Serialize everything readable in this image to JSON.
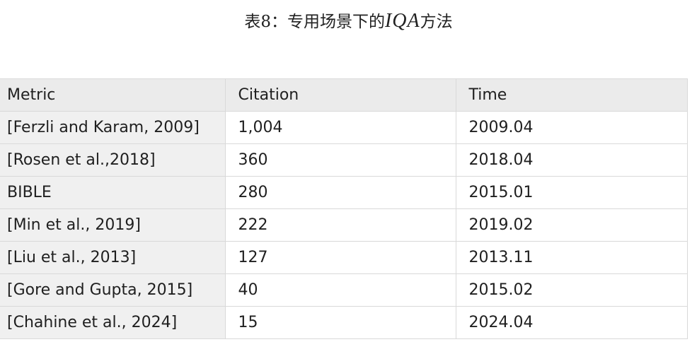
{
  "caption": {
    "prefix": "表8：专用场景下的",
    "math": "IQA",
    "suffix": "方法"
  },
  "table": {
    "headers": [
      "Metric",
      "Citation",
      "Time"
    ],
    "rows": [
      [
        "[Ferzli and Karam, 2009]",
        "1,004",
        "2009.04"
      ],
      [
        "[Rosen et al.,2018]",
        "360",
        "2018.04"
      ],
      [
        "BIBLE",
        "280",
        "2015.01"
      ],
      [
        "[Min et al., 2019]",
        "222",
        "2019.02"
      ],
      [
        "[Liu et al., 2013]",
        "127",
        "2013.11"
      ],
      [
        "[Gore and Gupta, 2015]",
        "40",
        "2015.02"
      ],
      [
        "[Chahine et al., 2024]",
        "15",
        "2024.04"
      ]
    ]
  }
}
